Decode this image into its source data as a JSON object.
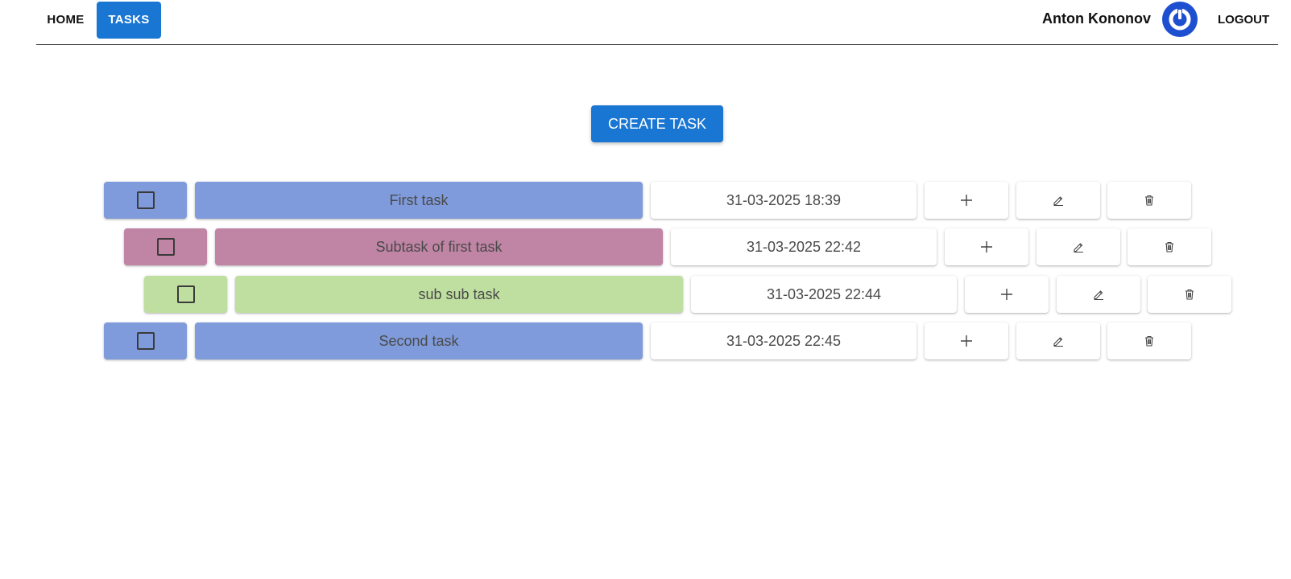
{
  "nav": {
    "home_label": "HOME",
    "tasks_label": "TASKS",
    "user_name": "Anton Kononov",
    "logout_label": "LOGOUT",
    "avatar_icon": "power-icon",
    "accent_color": "#1976d2"
  },
  "create_button_label": "CREATE TASK",
  "tasks": [
    {
      "title": "First task",
      "date": "31-03-2025 18:39",
      "level": 0,
      "checked": false,
      "color": "#7f9bdb"
    },
    {
      "title": "Subtask of first task",
      "date": "31-03-2025 22:42",
      "level": 1,
      "checked": false,
      "color": "#c084a5"
    },
    {
      "title": "sub sub task",
      "date": "31-03-2025 22:44",
      "level": 2,
      "checked": false,
      "color": "#bfdfa0"
    },
    {
      "title": "Second task",
      "date": "31-03-2025 22:45",
      "level": 0,
      "checked": false,
      "color": "#7f9bdb"
    }
  ],
  "row_icons": {
    "add": "plus-icon",
    "edit": "pencil-icon",
    "delete": "trash-icon"
  }
}
